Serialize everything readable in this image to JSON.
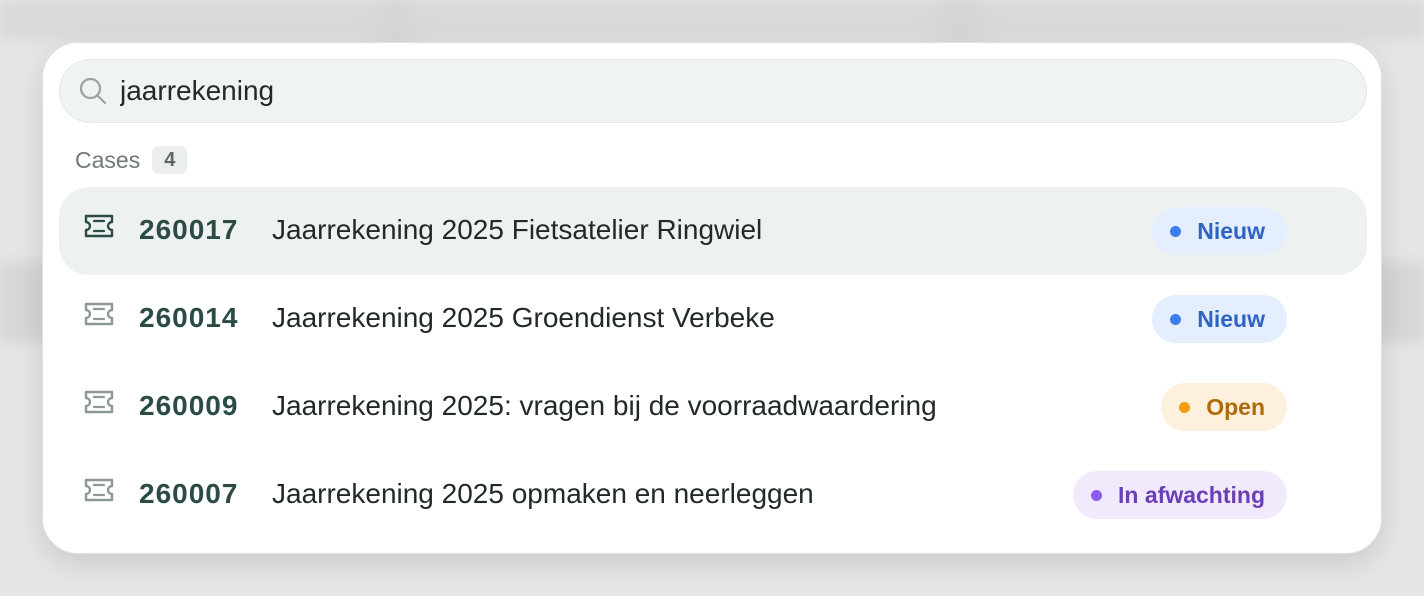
{
  "search": {
    "value": "jaarrekening",
    "icon": "search-icon"
  },
  "section": {
    "title": "Cases",
    "count": "4"
  },
  "cases": [
    {
      "number": "260017",
      "title": "Jaarrekening 2025 Fietsatelier Ringwiel",
      "status": "Nieuw",
      "status_color": "#2f63c4",
      "status_bg": "#e4eefc",
      "dot_color": "#3d7ef0",
      "selected": true,
      "icon": "ticket-icon"
    },
    {
      "number": "260014",
      "title": "Jaarrekening 2025 Groendienst Verbeke",
      "status": "Nieuw",
      "status_color": "#2f63c4",
      "status_bg": "#e4eefc",
      "dot_color": "#3d7ef0",
      "selected": false,
      "icon": "ticket-icon"
    },
    {
      "number": "260009",
      "title": "Jaarrekening 2025: vragen bij de voorraadwaardering",
      "status": "Open",
      "status_color": "#b16a0a",
      "status_bg": "#fdf0dc",
      "dot_color": "#f59b12",
      "selected": false,
      "icon": "ticket-icon"
    },
    {
      "number": "260007",
      "title": "Jaarrekening 2025 opmaken en neerleggen",
      "status": "In afwachting",
      "status_color": "#6b3fb5",
      "status_bg": "#f1eafc",
      "dot_color": "#8b5cf0",
      "selected": false,
      "icon": "ticket-icon"
    }
  ]
}
